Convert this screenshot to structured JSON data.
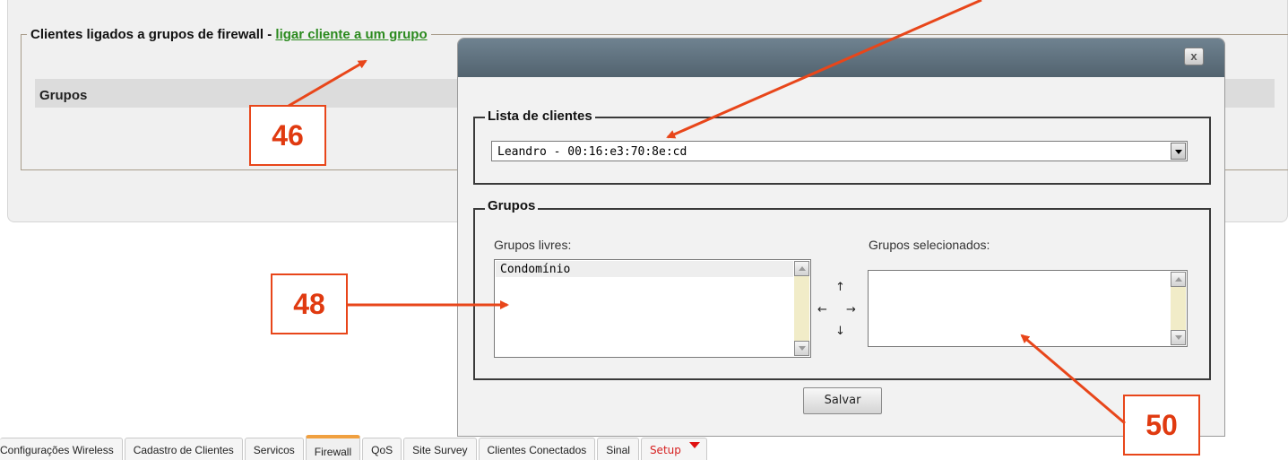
{
  "background": {
    "section_title": "Clientes ligados a grupos de firewall - ",
    "section_link": "ligar cliente a um grupo",
    "groups_header": "Grupos"
  },
  "tabs": [
    {
      "label": "Configurações Wireless"
    },
    {
      "label": "Cadastro de Clientes"
    },
    {
      "label": "Servicos"
    },
    {
      "label": "Firewall",
      "active": true
    },
    {
      "label": "QoS"
    },
    {
      "label": "Site Survey"
    },
    {
      "label": "Clientes Conectados"
    },
    {
      "label": "Sinal"
    },
    {
      "label": "Setup"
    }
  ],
  "modal": {
    "close_label": "x",
    "client_list": {
      "legend": "Lista de clientes",
      "selected": "Leandro - 00:16:e3:70:8e:cd"
    },
    "groups": {
      "legend": "Grupos",
      "free_label": "Grupos livres:",
      "free_items": [
        "Condomínio"
      ],
      "selected_label": "Grupos selecionados:",
      "selected_items": [],
      "move_up": "↑",
      "move_left": "←",
      "move_right": "→",
      "move_down": "↓"
    },
    "save_label": "Salvar"
  },
  "annotations": [
    {
      "label": "46"
    },
    {
      "label": "48"
    },
    {
      "label": "50"
    }
  ],
  "colors": {
    "annotation": "#e8461a",
    "link": "#2b8a1e",
    "titlebar": "#5c6d79",
    "active_tab": "#f0a040"
  }
}
